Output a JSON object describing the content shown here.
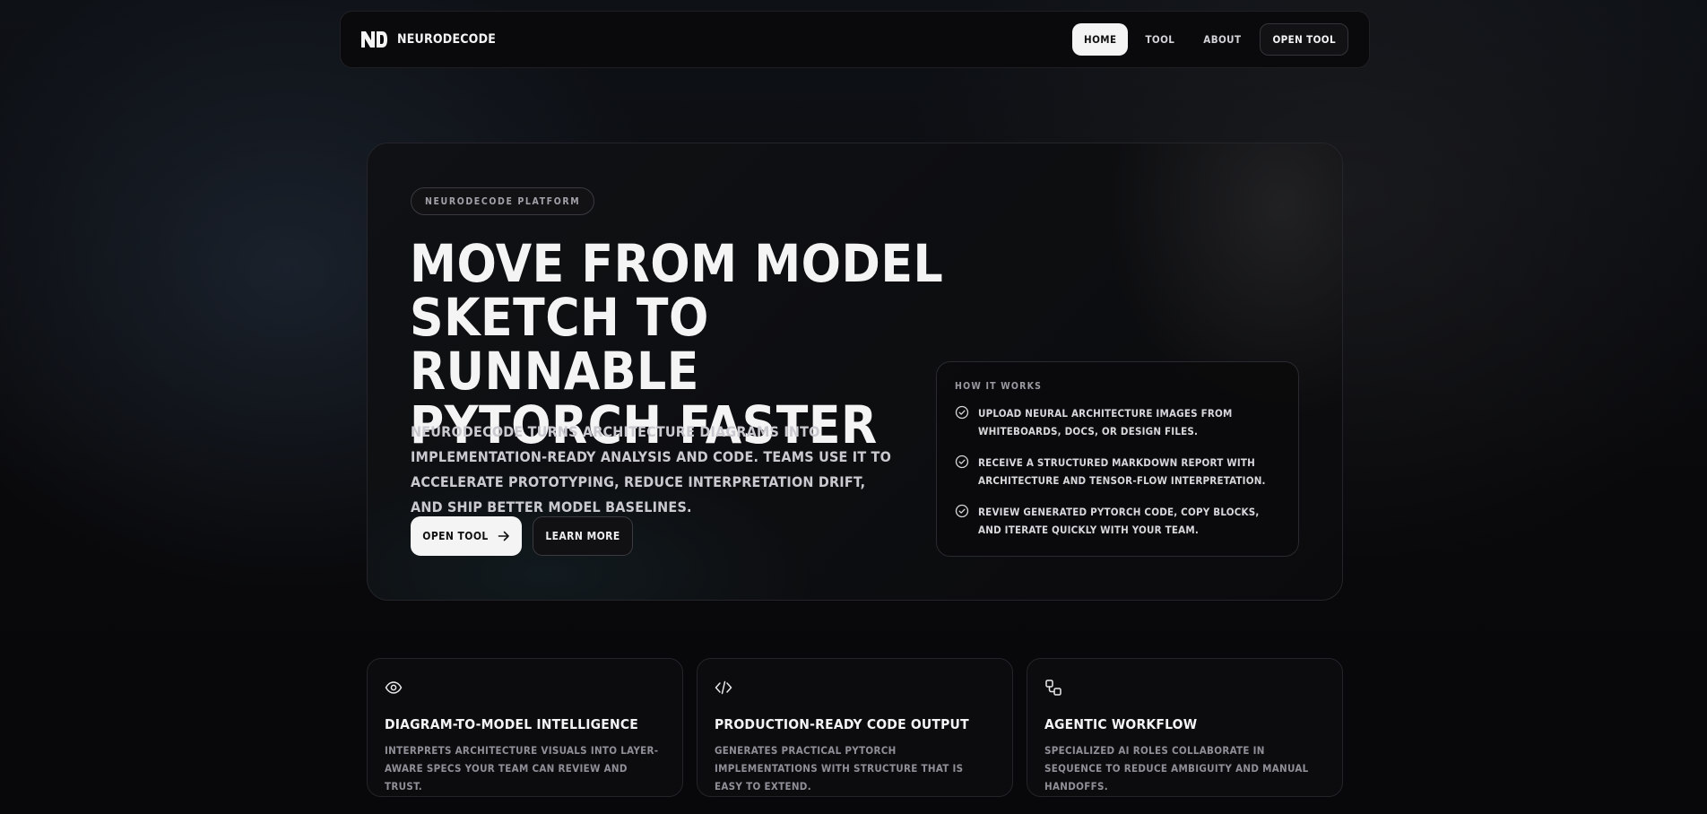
{
  "nav": {
    "brand": "NEURODECODE",
    "logo_icon": "nd-logo-icon",
    "links": [
      {
        "label": "HOME",
        "active": true
      },
      {
        "label": "TOOL",
        "active": false
      },
      {
        "label": "ABOUT",
        "active": false
      }
    ],
    "cta_label": "OPEN TOOL"
  },
  "hero": {
    "badge": "NEURODECODE PLATFORM",
    "title": "MOVE FROM MODEL SKETCH TO RUNNABLE PYTORCH FASTER",
    "description": "NEURODECODE TURNS ARCHITECTURE DIAGRAMS INTO IMPLEMENTATION-READY ANALYSIS AND CODE. TEAMS USE IT TO ACCELERATE PROTOTYPING, REDUCE INTERPRETATION DRIFT, AND SHIP BETTER MODEL BASELINES.",
    "primary_button": "OPEN TOOL",
    "primary_button_icon": "arrow-right-icon",
    "secondary_button": "LEARN MORE"
  },
  "how_it_works": {
    "title": "HOW IT WORKS",
    "item_icon": "check-circle-icon",
    "items": [
      "UPLOAD NEURAL ARCHITECTURE IMAGES FROM WHITEBOARDS, DOCS, OR DESIGN FILES.",
      "RECEIVE A STRUCTURED MARKDOWN REPORT WITH ARCHITECTURE AND TENSOR-FLOW INTERPRETATION.",
      "REVIEW GENERATED PYTORCH CODE, COPY BLOCKS, AND ITERATE QUICKLY WITH YOUR TEAM."
    ]
  },
  "features": [
    {
      "icon": "eye-icon",
      "title": "DIAGRAM-TO-MODEL INTELLIGENCE",
      "description": "INTERPRETS ARCHITECTURE VISUALS INTO LAYER-AWARE SPECS YOUR TEAM CAN REVIEW AND TRUST."
    },
    {
      "icon": "code-icon",
      "title": "PRODUCTION-READY CODE OUTPUT",
      "description": "GENERATES PRACTICAL PYTORCH IMPLEMENTATIONS WITH STRUCTURE THAT IS EASY TO EXTEND."
    },
    {
      "icon": "workflow-icon",
      "title": "AGENTIC WORKFLOW",
      "description": "SPECIALIZED AI ROLES COLLABORATE IN SEQUENCE TO REDUCE AMBIGUITY AND MANUAL HANDOFFS."
    }
  ],
  "colors": {
    "background": "#09090b",
    "surface": "#0c0c0e",
    "border": "#24242a",
    "text_primary": "#f4f4f5",
    "text_muted": "#8f8f98",
    "button_light": "#f4f4f5"
  }
}
